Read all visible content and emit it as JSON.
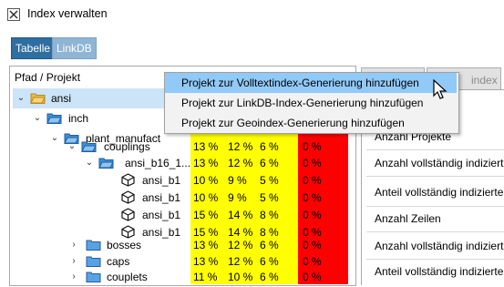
{
  "window": {
    "title": "Index verwalten"
  },
  "tabs": [
    {
      "label": "Tabelle"
    },
    {
      "label": "LinkDB"
    }
  ],
  "tree": {
    "header": "Pfad / Projekt",
    "nodes": [
      {
        "label": "ansi",
        "expanded": true
      },
      {
        "label": "inch",
        "expanded": true
      },
      {
        "label": "plant_manufact",
        "expanded": true
      },
      {
        "label": "couplings",
        "expanded": true
      },
      {
        "label": "ansi_b16_1...",
        "expanded": true
      },
      {
        "label": "ansi_b1"
      },
      {
        "label": "ansi_b1"
      },
      {
        "label": "ansi_b1"
      },
      {
        "label": "ansi_b1"
      },
      {
        "label": "bosses",
        "expanded": false
      },
      {
        "label": "caps",
        "expanded": false
      },
      {
        "label": "couplets",
        "expanded": false
      }
    ]
  },
  "percent_rows": [
    [
      "13 %",
      "12 %",
      "6 %",
      "0 %"
    ],
    [
      "13 %",
      "12 %",
      "6 %",
      "0 %"
    ],
    [
      "10 %",
      "9 %",
      "5 %",
      "0 %"
    ],
    [
      "10 %",
      "9 %",
      "5 %",
      "0 %"
    ],
    [
      "15 %",
      "14 %",
      "8 %",
      "0 %"
    ],
    [
      "15 %",
      "14 %",
      "8 %",
      "0 %"
    ],
    [
      "13 %",
      "12 %",
      "6 %",
      "0 %"
    ],
    [
      "13 %",
      "12 %",
      "6 %",
      "0 %"
    ],
    [
      "11 %",
      "10 %",
      "6 %",
      "0 %"
    ]
  ],
  "right_panel": {
    "button_partial": "index",
    "stats": [
      "Anzahl Projekte",
      "Anzahl vollständig indiziert",
      "Anteil vollständig indizierte",
      "Anzahl Zeilen",
      "Anzahl vollständig indiziert",
      "Anteil vollständig indizierte"
    ]
  },
  "context_menu": {
    "items": [
      {
        "label": "Projekt zur Volltextindex-Generierung hinzufügen"
      },
      {
        "label": "Projekt zur LinkDB-Index-Generierung hinzufügen"
      },
      {
        "label": "Projekt zur Geoindex-Generierung hinzufügen"
      }
    ]
  },
  "colors": {
    "yellow": "#ffff00",
    "red": "#ff0000",
    "selection": "#cce4f7",
    "menu_hover": "#91c9f7",
    "tab_active": "#2f6ea1"
  }
}
